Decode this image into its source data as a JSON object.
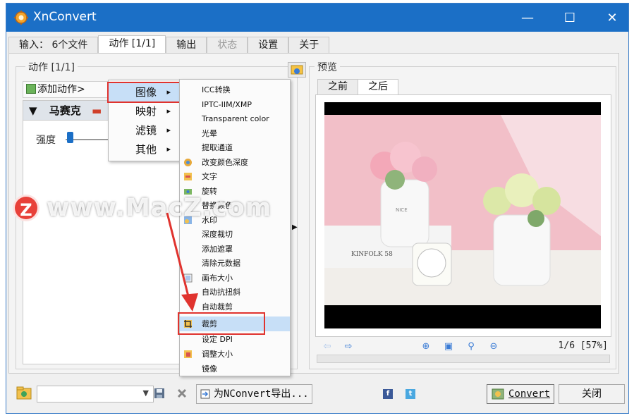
{
  "window": {
    "title": "XnConvert",
    "minimize": "—",
    "maximize": "☐",
    "close": "✕"
  },
  "tabs": [
    {
      "label": "输入： 6个文件"
    },
    {
      "label": "动作 [1/1]"
    },
    {
      "label": "输出"
    },
    {
      "label": "状态"
    },
    {
      "label": "设置"
    },
    {
      "label": "关于"
    }
  ],
  "actions_panel": {
    "group_label": "动作 [1/1]",
    "add_action": "添加动作>",
    "action_name": "马赛克",
    "strength_label": "强度"
  },
  "menu1": {
    "items": [
      {
        "label": "图像"
      },
      {
        "label": "映射"
      },
      {
        "label": "滤镜"
      },
      {
        "label": "其他"
      }
    ],
    "arrow": "▸"
  },
  "menu2": {
    "items": [
      {
        "label": "ICC转换"
      },
      {
        "label": "IPTC-IIM/XMP"
      },
      {
        "label": "Transparent color"
      },
      {
        "label": "光晕"
      },
      {
        "label": "提取通道"
      },
      {
        "label": "改变颜色深度"
      },
      {
        "label": "文字"
      },
      {
        "label": "旋转"
      },
      {
        "label": "替换颜色"
      },
      {
        "label": "水印"
      },
      {
        "label": "深度裁切"
      },
      {
        "label": "添加遮罩"
      },
      {
        "label": "清除元数据"
      },
      {
        "label": "画布大小"
      },
      {
        "label": "自动抗扭斜"
      },
      {
        "label": "自动裁剪"
      },
      {
        "label": "裁剪"
      },
      {
        "label": "设定 DPI"
      },
      {
        "label": "调整大小"
      },
      {
        "label": "镜像"
      }
    ]
  },
  "preview": {
    "group_label": "预览",
    "tab_before": "之前",
    "tab_after": "之后",
    "page_info": "1/6 [57%]",
    "photo_text_1": "KINFOLK 58",
    "photo_text_2": "NICE"
  },
  "bottom": {
    "export_label": "为NConvert导出...",
    "convert_label": "Convert",
    "close_label": "关闭"
  },
  "watermark": {
    "logo": "Z",
    "text": "www.MacZ.com"
  },
  "colors": {
    "titlebar": "#1b6fc6",
    "highlight": "#c7dff7",
    "red_annotation": "#e0332e"
  }
}
